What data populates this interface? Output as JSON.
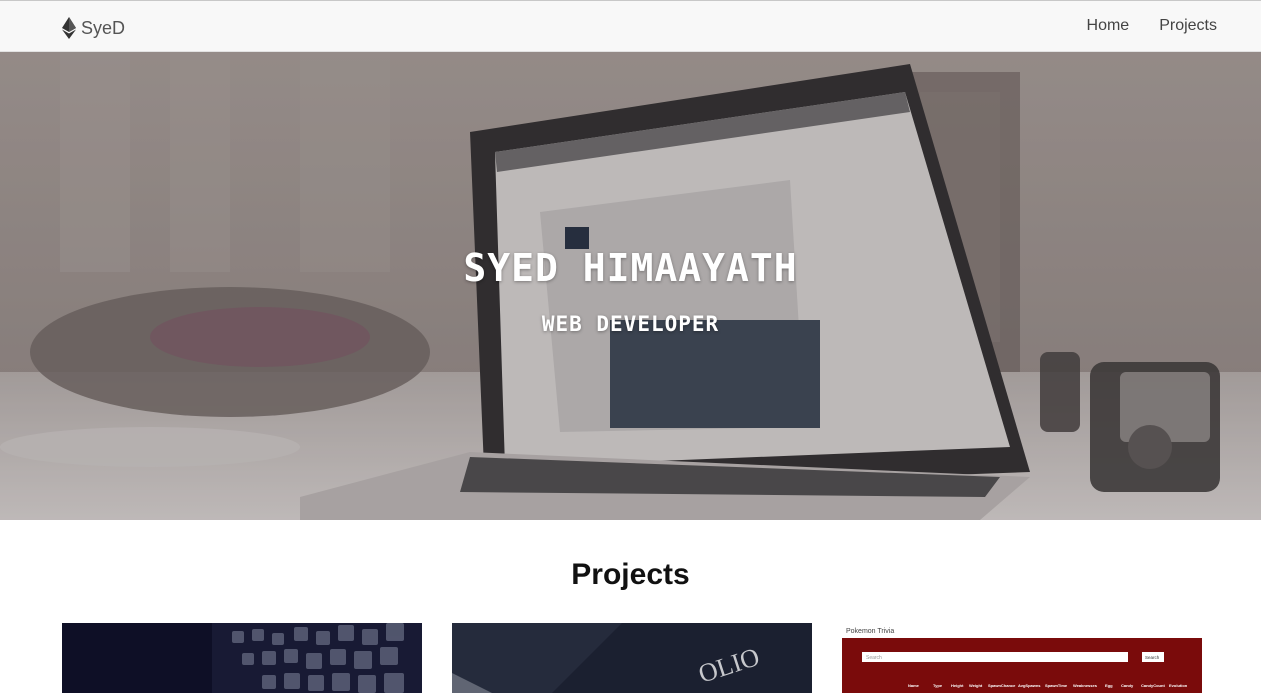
{
  "navbar": {
    "brand": {
      "icon": "ethereum-icon",
      "label": "SyeD"
    },
    "links": [
      {
        "label": "Home"
      },
      {
        "label": "Projects"
      }
    ]
  },
  "hero": {
    "title": "SYED HIMAAYATH",
    "subtitle": "WEB DEVELOPER"
  },
  "projects": {
    "heading": "Projects",
    "cards": [
      {
        "thumbnail": "dark-app-grid-thumbnail"
      },
      {
        "thumbnail": "portfolio-book-thumbnail"
      },
      {
        "thumbnail": "pokemon-trivia-thumbnail",
        "screenshot_title": "Pokemon Trivia",
        "search_placeholder": "Search",
        "search_button": "Search",
        "table_headers": [
          "Name",
          "Type",
          "Height",
          "Weight",
          "SpawnChance",
          "AvgSpawns",
          "SpawnTime",
          "Weaknesses",
          "Egg",
          "Candy",
          "CandyCount",
          "Evolution"
        ]
      }
    ]
  },
  "colors": {
    "navbar_bg": "#f8f8f8",
    "hero_text": "#ffffff",
    "heading_text": "#111111",
    "pokemon_red": "#7a0b0b"
  }
}
